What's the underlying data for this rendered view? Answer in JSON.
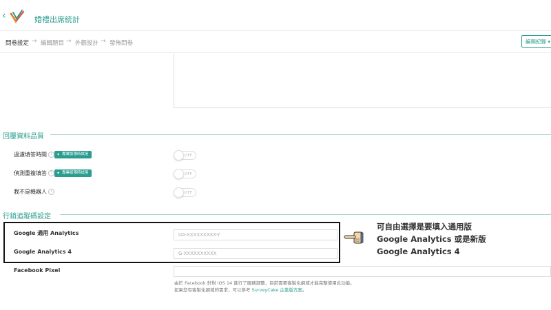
{
  "header": {
    "survey_title": "婚禮出席統計"
  },
  "steps": {
    "items": [
      {
        "label": "問卷設定",
        "active": true
      },
      {
        "label": "編輯題目",
        "active": false
      },
      {
        "label": "外觀設計",
        "active": false
      },
      {
        "label": "發佈問卷",
        "active": false
      }
    ],
    "arrow": "→",
    "edit_history_label": "編輯紀錄 ▾"
  },
  "response_quality": {
    "title": "回覆資料品質",
    "rows": [
      {
        "label": "過濾填答時間",
        "badge": "專業版限時試用",
        "toggle": "OFF"
      },
      {
        "label": "偵測重複填答",
        "badge": "專業版限時試用",
        "toggle": "OFF"
      },
      {
        "label": "我不是機器人",
        "badge": "",
        "toggle": "OFF"
      }
    ]
  },
  "tracking": {
    "title": "行銷追蹤碼設定",
    "rows": [
      {
        "label": "Google 通用 Analytics",
        "placeholder": "UA-XXXXXXXXX-Y"
      },
      {
        "label": "Google Analytics 4",
        "placeholder": "G-XXXXXXXXXX"
      },
      {
        "label": "Facebook Pixel",
        "placeholder": ""
      }
    ],
    "note_line1": "由於 Facebook 針對 iOS 14 進行了服務調整，目前需要客製化網域才能完整使用此功能。",
    "note_line2_prefix": "如果您有客製化網域的需求，可以參考 ",
    "note_link": "SurveyCake 企業版方案",
    "note_line2_suffix": "。"
  },
  "callout": {
    "line1": "可自由選擇是要填入通用版",
    "line2": "Google Analytics 或是新版",
    "line3": "Google Analytics 4"
  },
  "colors": {
    "accent": "#2a9d8f",
    "section_line": "#9fd3c7"
  }
}
